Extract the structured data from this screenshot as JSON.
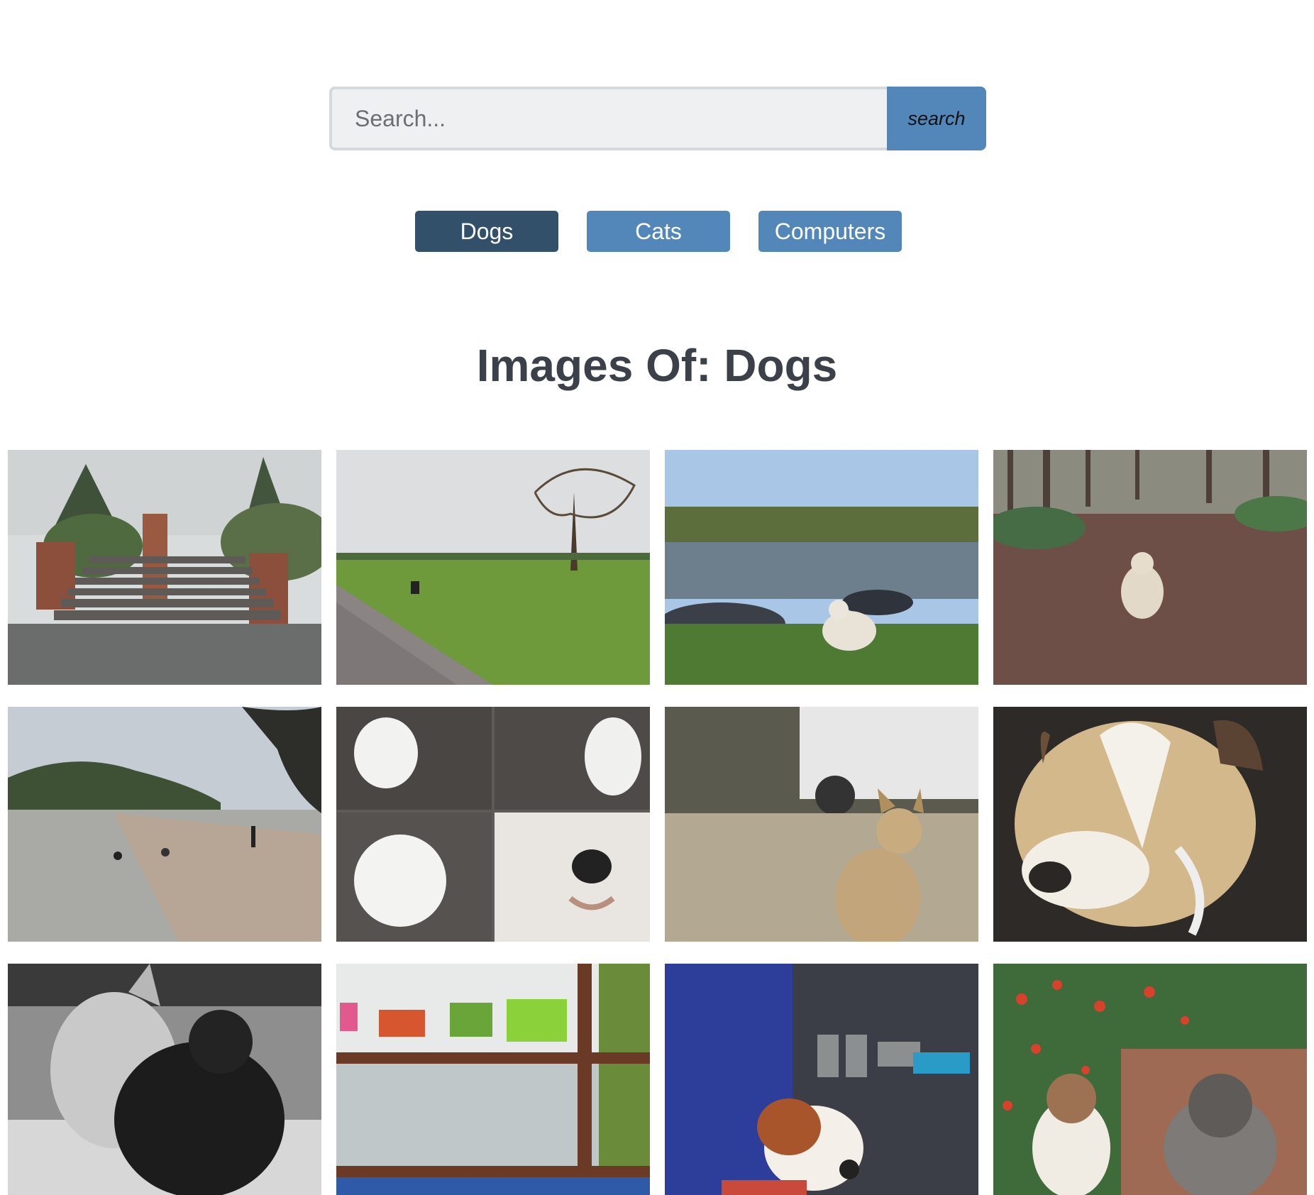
{
  "search": {
    "placeholder": "Search...",
    "value": "",
    "button_label": "search"
  },
  "tags": [
    {
      "label": "Dogs",
      "active": true
    },
    {
      "label": "Cats",
      "active": false
    },
    {
      "label": "Computers",
      "active": false
    }
  ],
  "heading": "Images Of: Dogs",
  "colors": {
    "accent": "#5387ba",
    "active_tag": "#33506b",
    "heading_text": "#3b4049",
    "input_bg": "#eef0f2",
    "input_border": "#d5d8dc"
  },
  "gallery": {
    "images": [
      {
        "name": "garden-stairs-photo"
      },
      {
        "name": "park-path-photo"
      },
      {
        "name": "lake-dog-photo"
      },
      {
        "name": "forest-leaves-dog-photo"
      },
      {
        "name": "beach-dogs-photo"
      },
      {
        "name": "sheepdog-collage-photo"
      },
      {
        "name": "street-dog-photo"
      },
      {
        "name": "pitbull-closeup-photo"
      },
      {
        "name": "bw-two-dogs-photo"
      },
      {
        "name": "dog-vests-store-photo"
      },
      {
        "name": "toy-dog-photo"
      },
      {
        "name": "flowers-two-dogs-photo"
      }
    ]
  }
}
